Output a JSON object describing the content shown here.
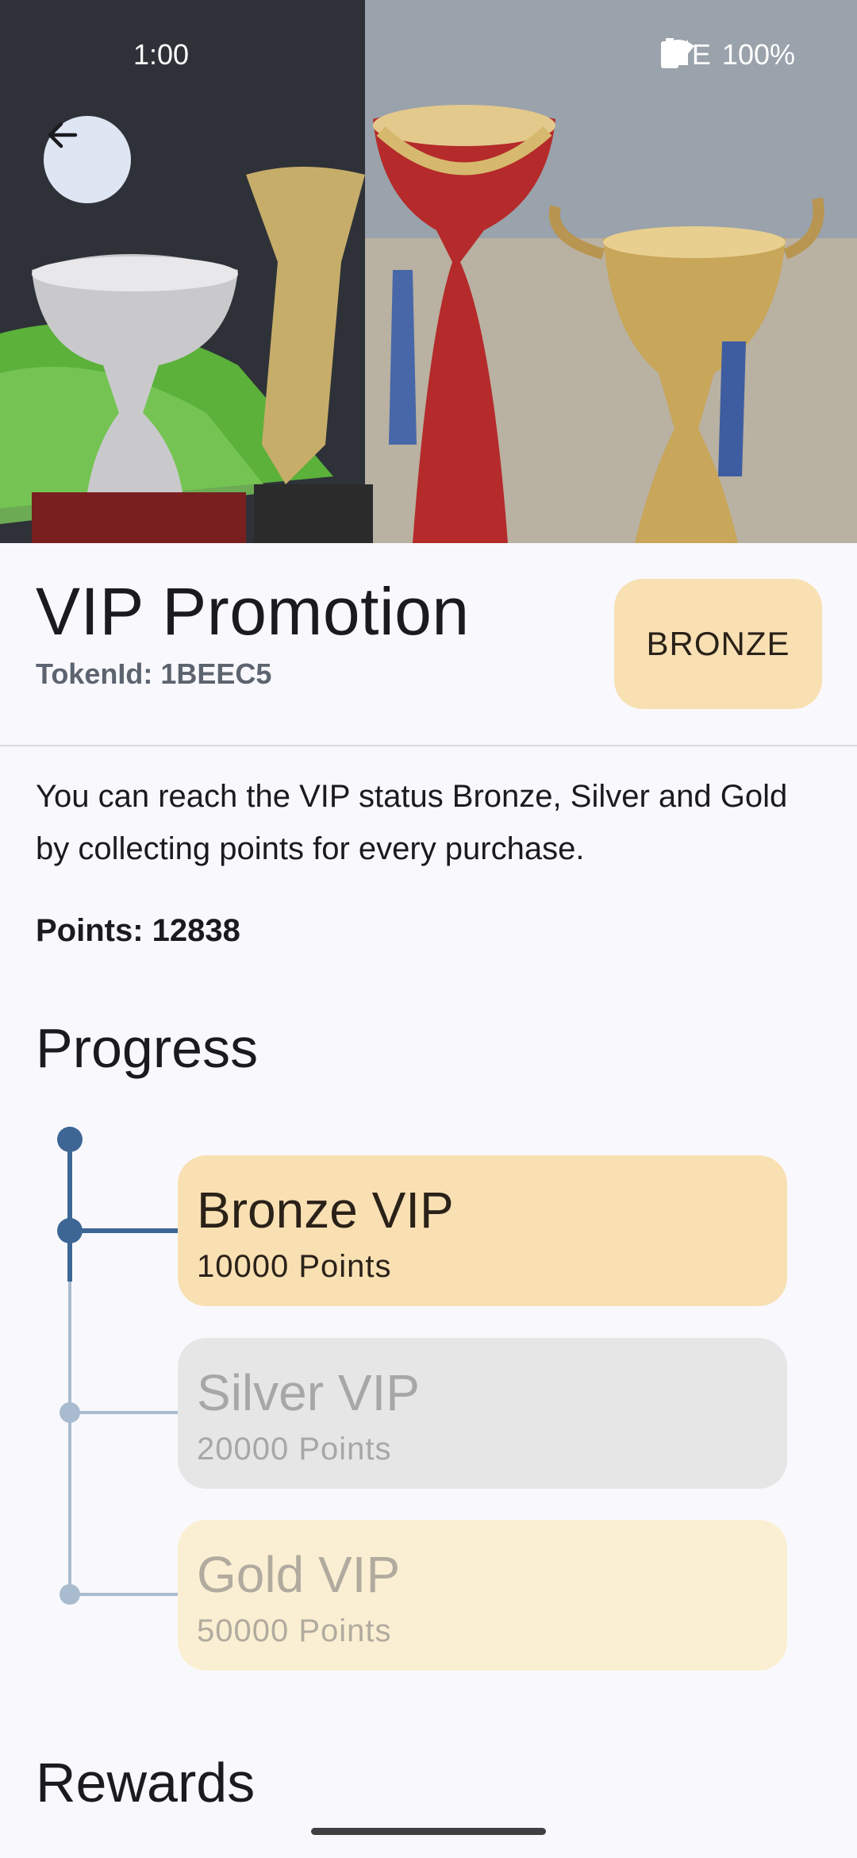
{
  "status_bar": {
    "time": "1:00",
    "network": "LTE",
    "battery": "100%"
  },
  "hero": {
    "image_alt": "trophies",
    "back_icon": "arrow-back-icon"
  },
  "header": {
    "title": "VIP Promotion",
    "token_id": "TokenId: 1BEEC5",
    "tier_badge": "BRONZE"
  },
  "description": "You can reach the VIP status Bronze, Silver and Gold by collecting points for every purchase.",
  "points_label": "Points: 12838",
  "progress": {
    "heading": "Progress",
    "tiers": [
      {
        "name": "Bronze VIP",
        "points": "10000 Points",
        "reached": true
      },
      {
        "name": "Silver VIP",
        "points": "20000 Points",
        "reached": false
      },
      {
        "name": "Gold VIP",
        "points": "50000 Points",
        "reached": false
      }
    ]
  },
  "rewards": {
    "heading": "Rewards"
  },
  "colors": {
    "accent": "#3d6694",
    "inactive_line": "#a9bbcf",
    "bronze_card": "#f8e0b3",
    "silver_card": "#e6e6e6",
    "gold_card": "#fbefd3"
  }
}
